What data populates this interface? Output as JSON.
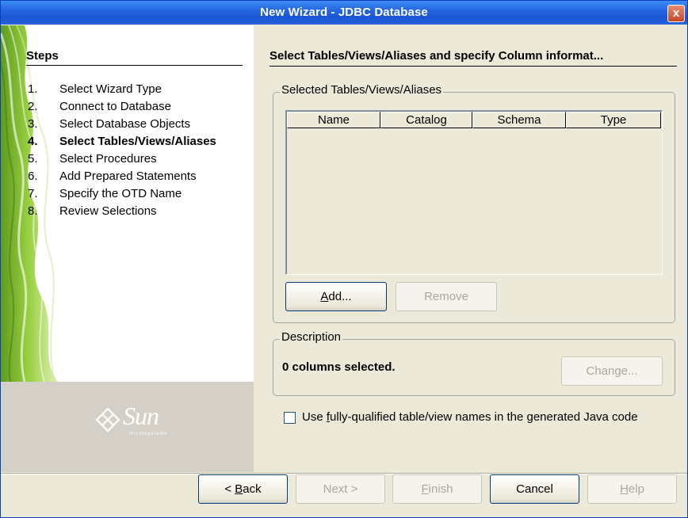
{
  "window": {
    "title": "New Wizard - JDBC Database",
    "close_glyph": "x",
    "close_icon": "close-icon"
  },
  "steps": {
    "heading": "Steps",
    "items": [
      {
        "num": "1.",
        "label": "Select Wizard Type",
        "current": false
      },
      {
        "num": "2.",
        "label": "Connect to Database",
        "current": false
      },
      {
        "num": "3.",
        "label": "Select Database Objects",
        "current": false
      },
      {
        "num": "4.",
        "label": "Select Tables/Views/Aliases",
        "current": true
      },
      {
        "num": "5.",
        "label": "Select Procedures",
        "current": false
      },
      {
        "num": "6.",
        "label": "Add Prepared Statements",
        "current": false
      },
      {
        "num": "7.",
        "label": "Specify the OTD Name",
        "current": false
      },
      {
        "num": "8.",
        "label": "Review Selections",
        "current": false
      }
    ],
    "logo": {
      "name": "Sun",
      "sub": "microsystems"
    }
  },
  "main": {
    "heading": "Select Tables/Views/Aliases and specify Column informat...",
    "selected_group": {
      "legend": "Selected Tables/Views/Aliases",
      "columns": [
        "Name",
        "Catalog",
        "Schema",
        "Type"
      ],
      "rows": []
    },
    "add_button": {
      "label": "Add...",
      "mnemonic": "A",
      "rest": "dd..."
    },
    "remove_button": {
      "label": "Remove"
    },
    "description": {
      "legend": "Description",
      "text": "0 columns selected.",
      "change_label": "Change..."
    },
    "fully_qualified": {
      "checked": false,
      "label": "Use fully-qualified table/view names in the generated Java code",
      "before": "Use ",
      "mnemonic": "f",
      "after": "ully-qualified table/view names in the generated Java code"
    }
  },
  "footer": {
    "back": {
      "label": "< Back",
      "before": "< ",
      "mnemonic": "B",
      "after": "ack"
    },
    "next": {
      "label": "Next >"
    },
    "finish": {
      "label": "Finish",
      "mnemonic": "F",
      "after": "inish"
    },
    "cancel": {
      "label": "Cancel"
    },
    "help": {
      "label": "Help",
      "mnemonic": "H",
      "after": "elp"
    }
  },
  "colors": {
    "titlebar": "#2566e0",
    "dialog_bg": "#ece9d8",
    "accent_green": "#7fbf2a",
    "logo_panel": "#d4d0c8"
  }
}
